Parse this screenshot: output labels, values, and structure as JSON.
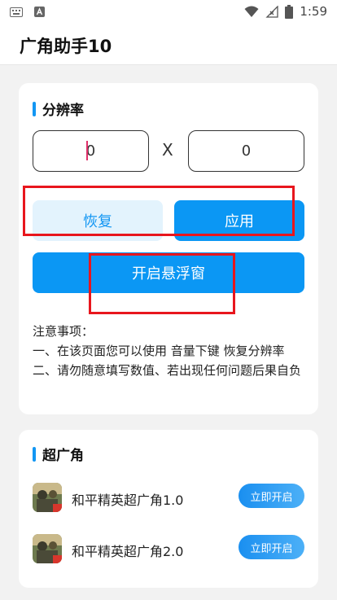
{
  "status_bar": {
    "time": "1:59",
    "icons": [
      "keyboard-icon",
      "a-notification-icon",
      "wifi-icon",
      "signal-icon",
      "battery-icon"
    ]
  },
  "app_bar": {
    "title": "广角助手10"
  },
  "resolution_card": {
    "title": "分辨率",
    "width_value": "0",
    "height_value": "0",
    "separator": "X",
    "restore_label": "恢复",
    "apply_label": "应用",
    "float_label": "开启悬浮窗",
    "notes": [
      "注意事项：",
      "一、在该页面您可以使用 音量下键 恢复分辨率",
      "二、请勿随意填写数值、若出现任何问题后果自负"
    ]
  },
  "wide_card": {
    "title": "超广角",
    "items": [
      {
        "name": "和平精英超广角1.0",
        "button": "立即开启"
      },
      {
        "name": "和平精英超广角2.0",
        "button": "立即开启"
      }
    ]
  },
  "colors": {
    "accent": "#0b97f4",
    "accent_light": "#e3f3fd",
    "annotation_red": "#e8161d",
    "background": "#f2f2f2"
  }
}
